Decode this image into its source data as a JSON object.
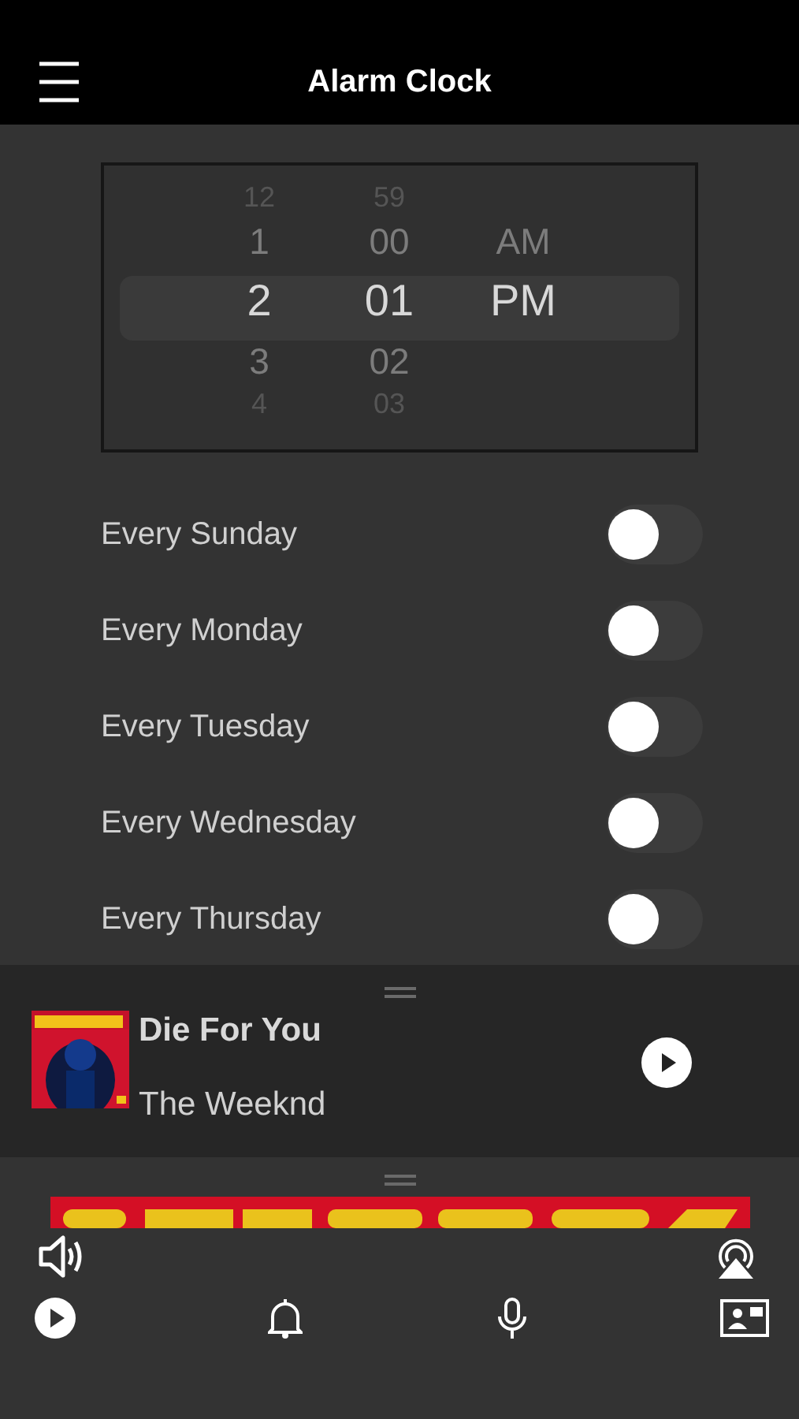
{
  "header": {
    "title": "Alarm Clock"
  },
  "picker": {
    "columns": [
      {
        "kind": "hour",
        "items": [
          {
            "text": "12",
            "selected": false
          },
          {
            "text": "1",
            "selected": false
          },
          {
            "text": "2",
            "selected": true
          },
          {
            "text": "3",
            "selected": false
          },
          {
            "text": "4",
            "selected": false
          }
        ]
      },
      {
        "kind": "minute",
        "items": [
          {
            "text": "59",
            "selected": false
          },
          {
            "text": "00",
            "selected": false
          },
          {
            "text": "01",
            "selected": true
          },
          {
            "text": "02",
            "selected": false
          },
          {
            "text": "03",
            "selected": false
          }
        ]
      },
      {
        "kind": "period",
        "items": [
          {
            "text": "AM",
            "selected": false
          },
          {
            "text": "PM",
            "selected": true
          }
        ]
      }
    ]
  },
  "alarms": [
    {
      "label": "Every Sunday",
      "on": false
    },
    {
      "label": "Every Monday",
      "on": false
    },
    {
      "label": "Every Tuesday",
      "on": false
    },
    {
      "label": "Every Wednesday",
      "on": false
    },
    {
      "label": "Every Thursday",
      "on": false
    }
  ],
  "now_playing": {
    "title": "Die For You",
    "artist": "The Weeknd"
  }
}
